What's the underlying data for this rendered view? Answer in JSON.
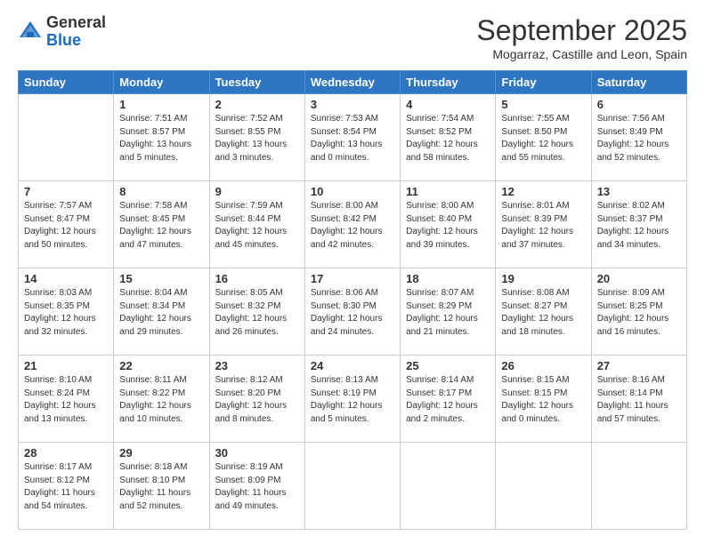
{
  "header": {
    "logo_general": "General",
    "logo_blue": "Blue",
    "month_title": "September 2025",
    "subtitle": "Mogarraz, Castille and Leon, Spain"
  },
  "weekdays": [
    "Sunday",
    "Monday",
    "Tuesday",
    "Wednesday",
    "Thursday",
    "Friday",
    "Saturday"
  ],
  "weeks": [
    [
      {
        "day": "",
        "info": ""
      },
      {
        "day": "1",
        "info": "Sunrise: 7:51 AM\nSunset: 8:57 PM\nDaylight: 13 hours\nand 5 minutes."
      },
      {
        "day": "2",
        "info": "Sunrise: 7:52 AM\nSunset: 8:55 PM\nDaylight: 13 hours\nand 3 minutes."
      },
      {
        "day": "3",
        "info": "Sunrise: 7:53 AM\nSunset: 8:54 PM\nDaylight: 13 hours\nand 0 minutes."
      },
      {
        "day": "4",
        "info": "Sunrise: 7:54 AM\nSunset: 8:52 PM\nDaylight: 12 hours\nand 58 minutes."
      },
      {
        "day": "5",
        "info": "Sunrise: 7:55 AM\nSunset: 8:50 PM\nDaylight: 12 hours\nand 55 minutes."
      },
      {
        "day": "6",
        "info": "Sunrise: 7:56 AM\nSunset: 8:49 PM\nDaylight: 12 hours\nand 52 minutes."
      }
    ],
    [
      {
        "day": "7",
        "info": "Sunrise: 7:57 AM\nSunset: 8:47 PM\nDaylight: 12 hours\nand 50 minutes."
      },
      {
        "day": "8",
        "info": "Sunrise: 7:58 AM\nSunset: 8:45 PM\nDaylight: 12 hours\nand 47 minutes."
      },
      {
        "day": "9",
        "info": "Sunrise: 7:59 AM\nSunset: 8:44 PM\nDaylight: 12 hours\nand 45 minutes."
      },
      {
        "day": "10",
        "info": "Sunrise: 8:00 AM\nSunset: 8:42 PM\nDaylight: 12 hours\nand 42 minutes."
      },
      {
        "day": "11",
        "info": "Sunrise: 8:00 AM\nSunset: 8:40 PM\nDaylight: 12 hours\nand 39 minutes."
      },
      {
        "day": "12",
        "info": "Sunrise: 8:01 AM\nSunset: 8:39 PM\nDaylight: 12 hours\nand 37 minutes."
      },
      {
        "day": "13",
        "info": "Sunrise: 8:02 AM\nSunset: 8:37 PM\nDaylight: 12 hours\nand 34 minutes."
      }
    ],
    [
      {
        "day": "14",
        "info": "Sunrise: 8:03 AM\nSunset: 8:35 PM\nDaylight: 12 hours\nand 32 minutes."
      },
      {
        "day": "15",
        "info": "Sunrise: 8:04 AM\nSunset: 8:34 PM\nDaylight: 12 hours\nand 29 minutes."
      },
      {
        "day": "16",
        "info": "Sunrise: 8:05 AM\nSunset: 8:32 PM\nDaylight: 12 hours\nand 26 minutes."
      },
      {
        "day": "17",
        "info": "Sunrise: 8:06 AM\nSunset: 8:30 PM\nDaylight: 12 hours\nand 24 minutes."
      },
      {
        "day": "18",
        "info": "Sunrise: 8:07 AM\nSunset: 8:29 PM\nDaylight: 12 hours\nand 21 minutes."
      },
      {
        "day": "19",
        "info": "Sunrise: 8:08 AM\nSunset: 8:27 PM\nDaylight: 12 hours\nand 18 minutes."
      },
      {
        "day": "20",
        "info": "Sunrise: 8:09 AM\nSunset: 8:25 PM\nDaylight: 12 hours\nand 16 minutes."
      }
    ],
    [
      {
        "day": "21",
        "info": "Sunrise: 8:10 AM\nSunset: 8:24 PM\nDaylight: 12 hours\nand 13 minutes."
      },
      {
        "day": "22",
        "info": "Sunrise: 8:11 AM\nSunset: 8:22 PM\nDaylight: 12 hours\nand 10 minutes."
      },
      {
        "day": "23",
        "info": "Sunrise: 8:12 AM\nSunset: 8:20 PM\nDaylight: 12 hours\nand 8 minutes."
      },
      {
        "day": "24",
        "info": "Sunrise: 8:13 AM\nSunset: 8:19 PM\nDaylight: 12 hours\nand 5 minutes."
      },
      {
        "day": "25",
        "info": "Sunrise: 8:14 AM\nSunset: 8:17 PM\nDaylight: 12 hours\nand 2 minutes."
      },
      {
        "day": "26",
        "info": "Sunrise: 8:15 AM\nSunset: 8:15 PM\nDaylight: 12 hours\nand 0 minutes."
      },
      {
        "day": "27",
        "info": "Sunrise: 8:16 AM\nSunset: 8:14 PM\nDaylight: 11 hours\nand 57 minutes."
      }
    ],
    [
      {
        "day": "28",
        "info": "Sunrise: 8:17 AM\nSunset: 8:12 PM\nDaylight: 11 hours\nand 54 minutes."
      },
      {
        "day": "29",
        "info": "Sunrise: 8:18 AM\nSunset: 8:10 PM\nDaylight: 11 hours\nand 52 minutes."
      },
      {
        "day": "30",
        "info": "Sunrise: 8:19 AM\nSunset: 8:09 PM\nDaylight: 11 hours\nand 49 minutes."
      },
      {
        "day": "",
        "info": ""
      },
      {
        "day": "",
        "info": ""
      },
      {
        "day": "",
        "info": ""
      },
      {
        "day": "",
        "info": ""
      }
    ]
  ]
}
